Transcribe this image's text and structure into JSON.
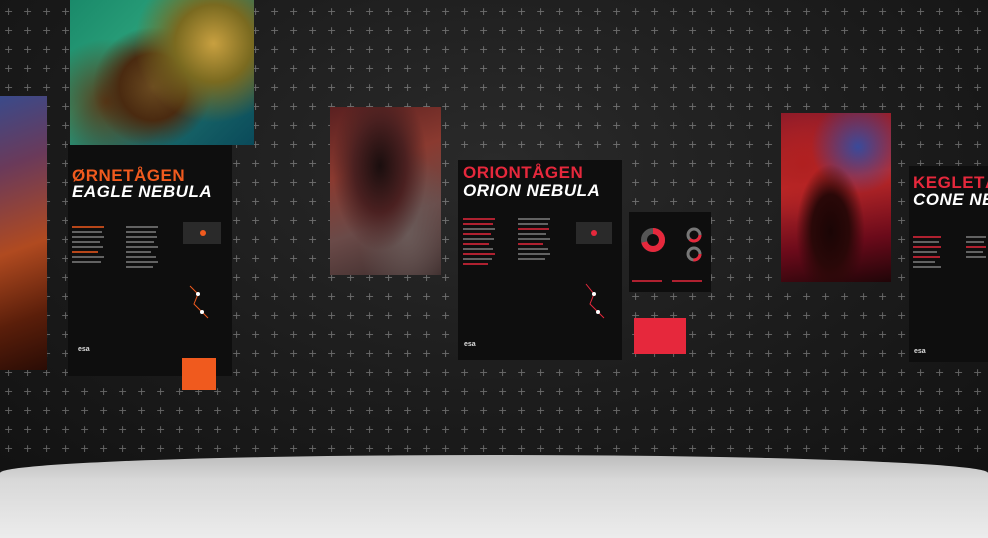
{
  "exhibits": {
    "eagle": {
      "title_native": "ØRNETÅGEN",
      "title_en": "EAGLE NEBULA",
      "accent": "#f05a1e"
    },
    "orion": {
      "title_native": "ORIONTÅGEN",
      "title_en": "ORION NEBULA",
      "accent": "#e6283c"
    },
    "cone": {
      "title_native": "KEGLETÅ",
      "title_en": "CONE NE",
      "accent": "#e6283c"
    }
  },
  "logo_text": "esa",
  "colors": {
    "wall": "#1c1c1c",
    "floor": "#d8d8d8",
    "panel": "#0e0e0e"
  }
}
